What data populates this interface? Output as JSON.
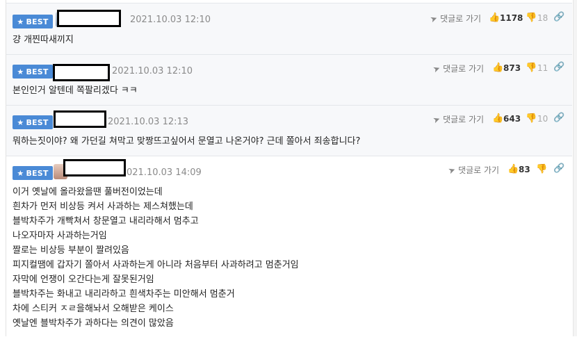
{
  "comments": [
    {
      "badge": "BEST",
      "date": "2021.10.03 12:10",
      "reply_label": "댓글로 가기",
      "likes": "1178",
      "dislikes": "18",
      "lines": [
        "걍 개찐따새끼지"
      ]
    },
    {
      "badge": "BEST",
      "date": "2021.10.03 12:10",
      "reply_label": "댓글로 가기",
      "likes": "873",
      "dislikes": "11",
      "lines": [
        "본인인거 알텐데 쪽팔리겠다 ㅋㅋ"
      ]
    },
    {
      "badge": "BEST",
      "date": "2021.10.03 12:13",
      "reply_label": "댓글로 가기",
      "likes": "643",
      "dislikes": "10",
      "lines": [
        "뭐하는짓이야? 왜 가던길 쳐막고 맞짱뜨고싶어서 문열고 나온거야? 근데 쫄아서 죄송합니다?"
      ]
    },
    {
      "badge": "BEST",
      "date": "021.10.03 14:09",
      "reply_label": "댓글로 가기",
      "likes": "83",
      "dislikes": "",
      "lines": [
        "이거 옛날에 올라왔을땐 풀버전이었는데",
        "흰차가 먼저 비상등 켜서 사과하는 제스쳐했는데",
        "블박차주가 개빡쳐서 창문열고 내리라해서 멈추고",
        "나오자마자 사과하는거임",
        "짤로는 비상등 부분이 짤려있음",
        "피지컬땜에 갑자기 쫄아서 사과하는게 아니라 처음부터 사과하려고 멈춘거임",
        "자막에 언쟁이 오간다는게 잘못된거임",
        "블박차주는 화내고 내리라하고 흰색차주는 미안해서 멈춘거",
        "차에 스티커 ㅈㄹ을해놔서 오해받은 케이스",
        "옛날엔 블박차주가 과하다는 의견이 많았음"
      ]
    }
  ],
  "icons": {
    "badge_star": "star-icon",
    "reply": "send-icon",
    "like": "thumbs-up-icon",
    "dislike": "thumbs-down-icon",
    "link": "link-icon"
  },
  "colors": {
    "badge_bg": "#4a8ad6",
    "row_bg": "#f7f8fa"
  }
}
